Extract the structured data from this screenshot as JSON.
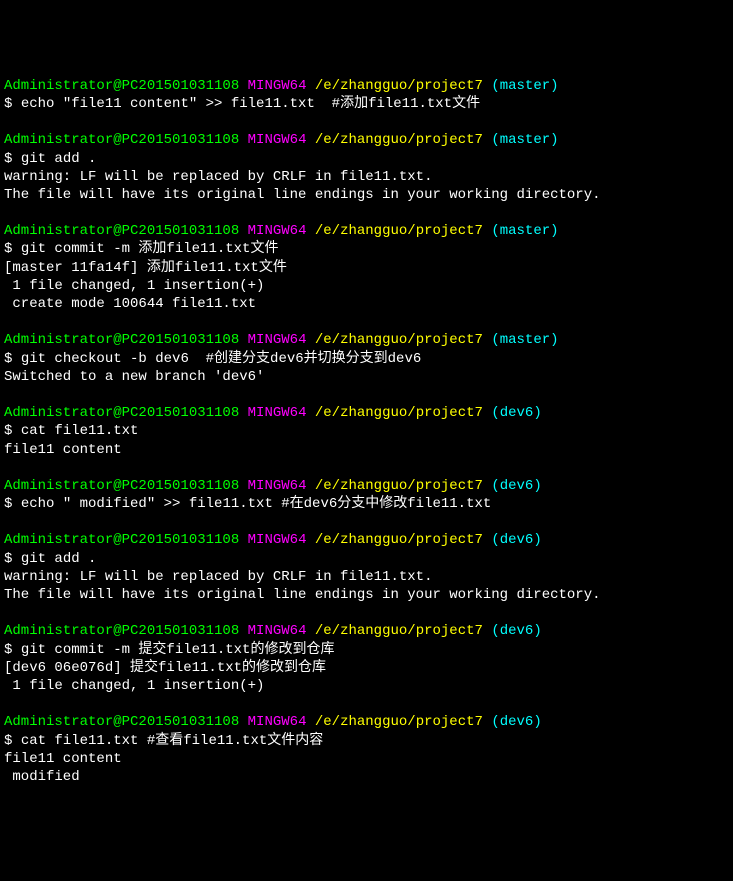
{
  "blocks": [
    {
      "prompt": {
        "user_host": "Administrator@PC201501031108",
        "mingw": "MINGW64",
        "path": "/e/zhangguo/project7",
        "branch": "(master)"
      },
      "command": "echo \"file11 content\" >> file11.txt  #添加file11.txt文件",
      "output": []
    },
    {
      "prompt": {
        "user_host": "Administrator@PC201501031108",
        "mingw": "MINGW64",
        "path": "/e/zhangguo/project7",
        "branch": "(master)"
      },
      "command": "git add .",
      "output": [
        "warning: LF will be replaced by CRLF in file11.txt.",
        "The file will have its original line endings in your working directory."
      ]
    },
    {
      "prompt": {
        "user_host": "Administrator@PC201501031108",
        "mingw": "MINGW64",
        "path": "/e/zhangguo/project7",
        "branch": "(master)"
      },
      "command": "git commit -m 添加file11.txt文件",
      "output": [
        "[master 11fa14f] 添加file11.txt文件",
        " 1 file changed, 1 insertion(+)",
        " create mode 100644 file11.txt"
      ]
    },
    {
      "prompt": {
        "user_host": "Administrator@PC201501031108",
        "mingw": "MINGW64",
        "path": "/e/zhangguo/project7",
        "branch": "(master)"
      },
      "command": "git checkout -b dev6  #创建分支dev6并切换分支到dev6",
      "output": [
        "Switched to a new branch 'dev6'"
      ]
    },
    {
      "prompt": {
        "user_host": "Administrator@PC201501031108",
        "mingw": "MINGW64",
        "path": "/e/zhangguo/project7",
        "branch": "(dev6)"
      },
      "command": "cat file11.txt",
      "output": [
        "file11 content"
      ]
    },
    {
      "prompt": {
        "user_host": "Administrator@PC201501031108",
        "mingw": "MINGW64",
        "path": "/e/zhangguo/project7",
        "branch": "(dev6)"
      },
      "command": "echo \" modified\" >> file11.txt #在dev6分支中修改file11.txt",
      "output": []
    },
    {
      "prompt": {
        "user_host": "Administrator@PC201501031108",
        "mingw": "MINGW64",
        "path": "/e/zhangguo/project7",
        "branch": "(dev6)"
      },
      "command": "git add .",
      "output": [
        "warning: LF will be replaced by CRLF in file11.txt.",
        "The file will have its original line endings in your working directory."
      ]
    },
    {
      "prompt": {
        "user_host": "Administrator@PC201501031108",
        "mingw": "MINGW64",
        "path": "/e/zhangguo/project7",
        "branch": "(dev6)"
      },
      "command": "git commit -m 提交file11.txt的修改到仓库",
      "output": [
        "[dev6 06e076d] 提交file11.txt的修改到仓库",
        " 1 file changed, 1 insertion(+)"
      ]
    },
    {
      "prompt": {
        "user_host": "Administrator@PC201501031108",
        "mingw": "MINGW64",
        "path": "/e/zhangguo/project7",
        "branch": "(dev6)"
      },
      "command": "cat file11.txt #查看file11.txt文件内容",
      "output": [
        "file11 content",
        " modified"
      ]
    }
  ]
}
